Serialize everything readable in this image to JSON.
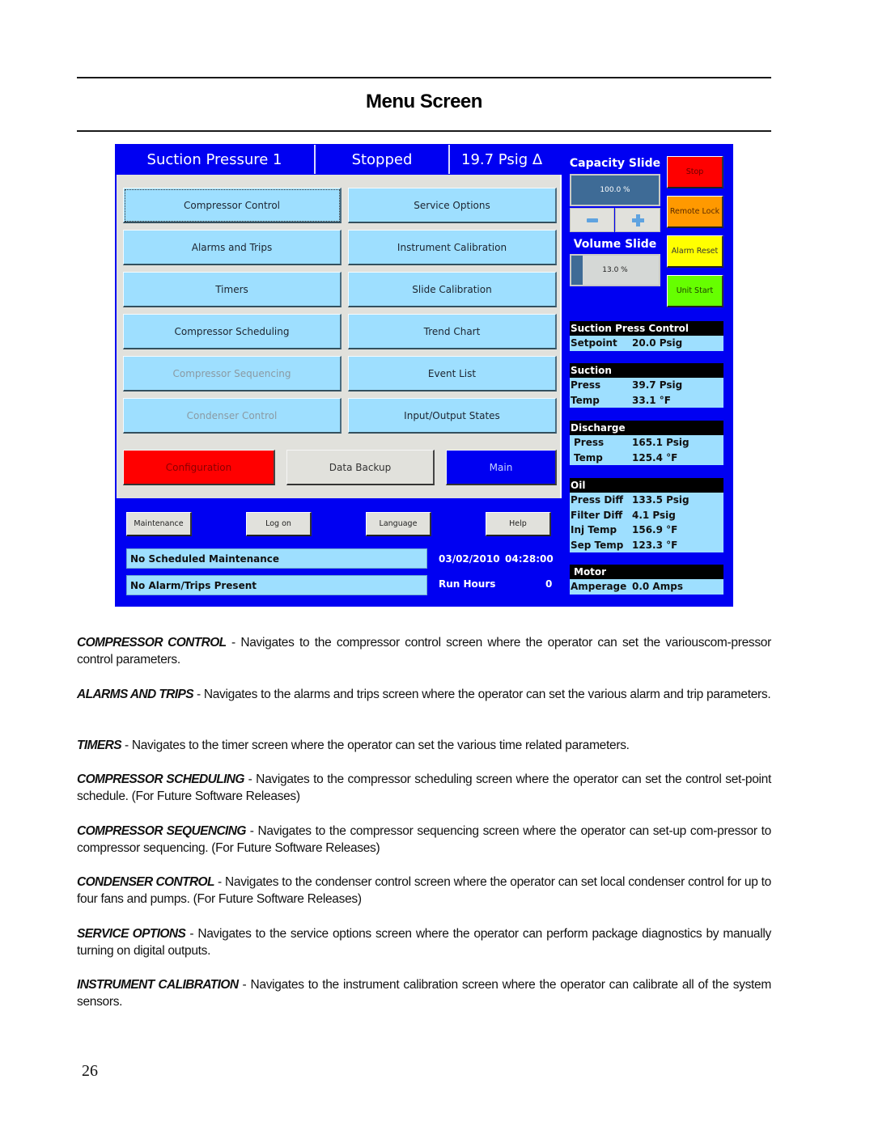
{
  "page": {
    "title": "Menu Screen",
    "page_number": "26"
  },
  "hmi": {
    "header": {
      "screen_name": "Suction Pressure 1",
      "status": "Stopped",
      "delta_value": "19.7 Psig Δ"
    },
    "menu_buttons": [
      {
        "label": "Compressor Control",
        "enabled": true,
        "focused": true
      },
      {
        "label": "Service Options",
        "enabled": true
      },
      {
        "label": "Alarms and Trips",
        "enabled": true
      },
      {
        "label": "Instrument Calibration",
        "enabled": true
      },
      {
        "label": "Timers",
        "enabled": true
      },
      {
        "label": "Slide Calibration",
        "enabled": true
      },
      {
        "label": "Compressor Scheduling",
        "enabled": true
      },
      {
        "label": "Trend Chart",
        "enabled": true
      },
      {
        "label": "Compressor Sequencing",
        "enabled": false
      },
      {
        "label": "Event List",
        "enabled": true
      },
      {
        "label": "Condenser Control",
        "enabled": false
      },
      {
        "label": "Input/Output States",
        "enabled": true
      }
    ],
    "bottom_buttons": {
      "configuration": "Configuration",
      "data_backup": "Data Backup",
      "main": "Main"
    },
    "footer_buttons": {
      "maintenance": "Maintenance",
      "log_on": "Log on",
      "language": "Language",
      "help": "Help"
    },
    "status": {
      "maintenance_message": "No Scheduled Maintenance",
      "alarm_message": "No Alarm/Trips Present",
      "date": "03/02/2010",
      "time": "04:28:00",
      "run_hours_label": "Run Hours",
      "run_hours_value": "0"
    },
    "capacity_slide": {
      "label": "Capacity Slide",
      "value_text": "100.0 %",
      "percent": 100,
      "minus_icon": "minus-icon",
      "plus_icon": "plus-icon"
    },
    "volume_slide": {
      "label": "Volume Slide",
      "value_text": "13.0 %",
      "percent": 13
    },
    "action_buttons": {
      "stop": "Stop",
      "remote_lock": "Remote Lock",
      "alarm_reset": "Alarm Reset",
      "unit_start": "Unit Start"
    },
    "colors": {
      "screen_blue": "#0000f2",
      "button_cyan": "#9edfff",
      "stop_red": "#ff0000",
      "remote_lock_orange": "#ff9900",
      "alarm_reset_yellow": "#ffff00",
      "unit_start_green": "#66ff00",
      "configuration_red": "#ff0000",
      "main_blue": "#0000f2"
    },
    "readouts": {
      "suction_press_control": {
        "title": "Suction Press Control",
        "rows": [
          {
            "label": "Setpoint",
            "value": "20.0 Psig"
          }
        ]
      },
      "suction": {
        "title": "Suction",
        "rows": [
          {
            "label": "Press",
            "value": "39.7 Psig"
          },
          {
            "label": "Temp",
            "value": "33.1 °F"
          }
        ]
      },
      "discharge": {
        "title": "Discharge",
        "rows": [
          {
            "label": "Press",
            "value": "165.1 Psig"
          },
          {
            "label": "Temp",
            "value": "125.4 °F"
          }
        ]
      },
      "oil": {
        "title": "Oil",
        "rows": [
          {
            "label": "Press Diff",
            "value": "133.5 Psig"
          },
          {
            "label": "Filter Diff",
            "value": "4.1 Psig"
          },
          {
            "label": "Inj Temp",
            "value": "156.9 °F"
          },
          {
            "label": "Sep Temp",
            "value": "123.3 °F"
          }
        ]
      },
      "motor": {
        "title": "Motor",
        "rows": [
          {
            "label": "Amperage",
            "value": "0.0 Amps"
          }
        ]
      }
    }
  },
  "descriptions": [
    {
      "term": "COMPRESSOR CONTROL",
      "text": " - Navigates to the compressor control screen where the operator can set the variouscom-pressor control parameters."
    },
    {
      "term": "ALARMS AND TRIPS",
      "text": " - Navigates to the alarms and trips screen where the operator can set the various alarm and trip parameters."
    },
    {
      "term": "TIMERS",
      "text": " - Navigates to the timer screen where the operator can set the various time related parameters."
    },
    {
      "term": "COMPRESSOR SCHEDULING",
      "text": " - Navigates to the compressor scheduling screen where the operator can set the control set-point schedule.  (For Future Software Releases)"
    },
    {
      "term": "COMPRESSOR SEQUENCING",
      "text": " - Navigates to the compressor sequencing screen where the operator can set-up com-pressor to compressor sequencing.  (For Future Software Releases)"
    },
    {
      "term": "CONDENSER CONTROL",
      "text": " - Navigates to the condenser control screen where the operator can set local condenser control for up to four fans and pumps.  (For Future Software Releases)"
    },
    {
      "term": "SERVICE OPTIONS",
      "text": " - Navigates to the service options screen where the operator can perform package diagnostics by manually turning on digital outputs."
    },
    {
      "term": "INSTRUMENT CALIBRATION",
      "text": " - Navigates to the instrument calibration screen where the operator can calibrate all of the system sensors."
    }
  ]
}
